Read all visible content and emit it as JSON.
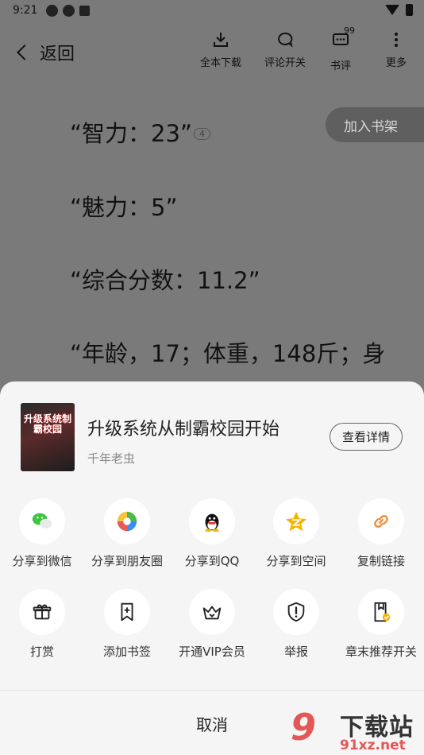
{
  "status": {
    "time": "9:21"
  },
  "topbar": {
    "back_label": "返回",
    "tools": [
      {
        "label": "全本下载",
        "icon": "download-icon"
      },
      {
        "label": "评论开关",
        "icon": "comment-toggle-icon"
      },
      {
        "label": "书评",
        "icon": "book-review-icon",
        "badge": "99"
      },
      {
        "label": "更多",
        "icon": "more-icon"
      }
    ]
  },
  "reader": {
    "lines": [
      "“智力：23”",
      "“魅力：5”",
      "“综合分数：11.2”",
      "“年龄，17；体重，148斤；身"
    ],
    "comment_count": "4",
    "add_shelf": "加入书架"
  },
  "sheet": {
    "book": {
      "cover_title": "升级系统制霸校园",
      "title": "升级系统从制霸校园开始",
      "author": "千年老虫"
    },
    "detail_button": "查看详情",
    "share_items": [
      {
        "label": "分享到微信",
        "icon": "wechat-icon"
      },
      {
        "label": "分享到朋友圈",
        "icon": "moments-icon"
      },
      {
        "label": "分享到QQ",
        "icon": "qq-icon"
      },
      {
        "label": "分享到空间",
        "icon": "qzone-icon"
      },
      {
        "label": "复制链接",
        "icon": "link-icon"
      }
    ],
    "action_items": [
      {
        "label": "打赏",
        "icon": "gift-icon"
      },
      {
        "label": "添加书签",
        "icon": "bookmark-add-icon"
      },
      {
        "label": "开通VIP会员",
        "icon": "crown-icon"
      },
      {
        "label": "举报",
        "icon": "shield-report-icon"
      },
      {
        "label": "章末推荐开关",
        "icon": "chapter-recommend-icon"
      }
    ],
    "cancel": "取消"
  },
  "watermark": {
    "logo": "9",
    "text": "下载站",
    "url": "91xz.net"
  },
  "colors": {
    "accent_orange": "#f0a030",
    "wechat_green": "#3fc441",
    "link_orange": "#f08a3a"
  }
}
